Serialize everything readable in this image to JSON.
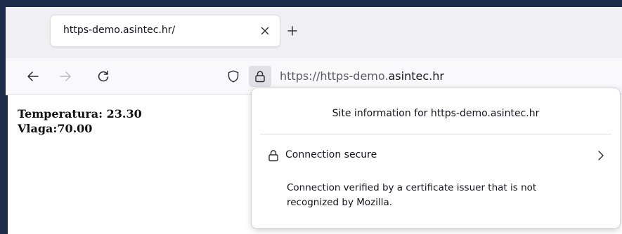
{
  "tab": {
    "title": "https-demo.asintec.hr/"
  },
  "navbar": {
    "url_prefix": "https://https-demo.",
    "url_domain": "asintec.hr"
  },
  "page": {
    "temperature_label": "Temperatura: ",
    "temperature_value": "23.30",
    "humidity_label": "Vlaga:",
    "humidity_value": "70.00"
  },
  "popup": {
    "header": "Site information for https-demo.asintec.hr",
    "connection_label": "Connection secure",
    "connection_detail": "Connection verified by a certificate issuer that is not recognized by Mozilla."
  },
  "icons": {
    "close": "close-icon",
    "new_tab": "plus-icon",
    "back": "arrow-left-icon",
    "forward": "arrow-right-icon",
    "reload": "reload-icon",
    "tracking": "shield-icon",
    "lock": "lock-icon",
    "chevron": "chevron-right-icon"
  }
}
